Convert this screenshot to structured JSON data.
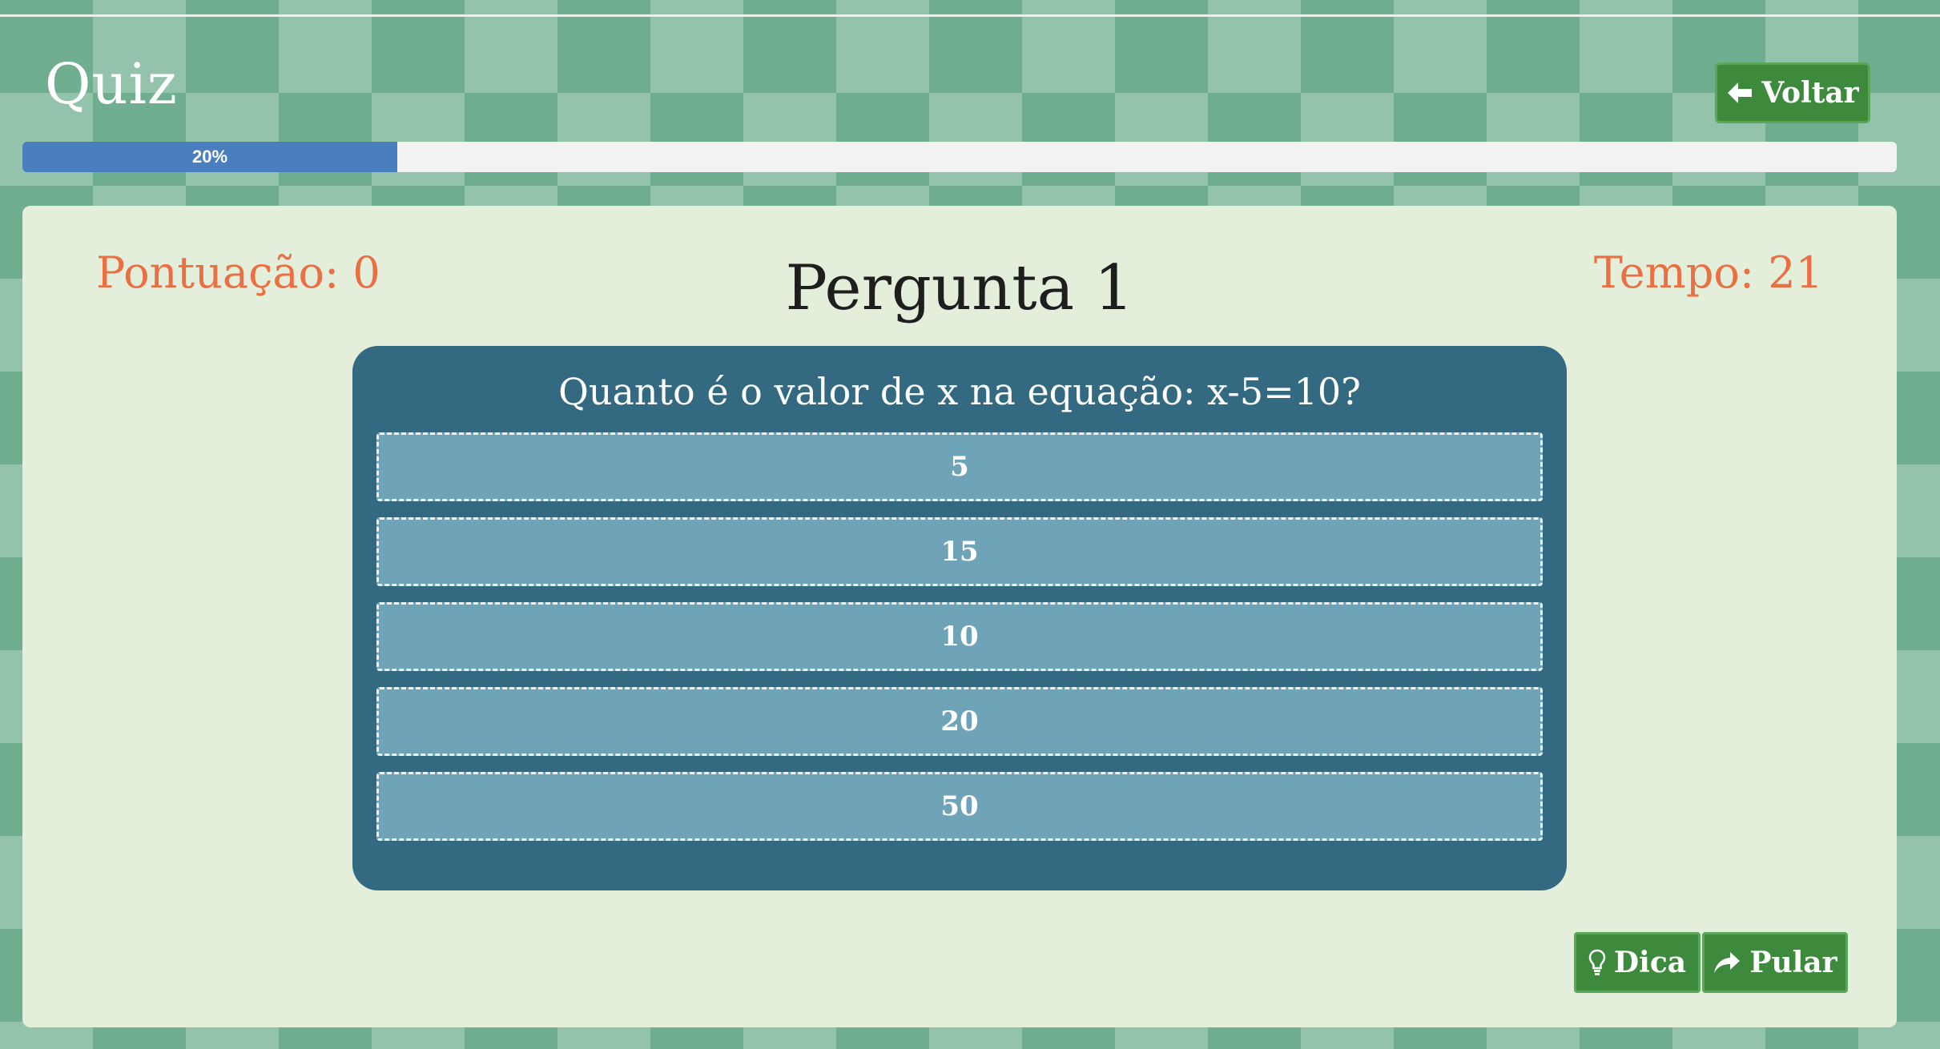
{
  "header": {
    "title": "Quiz",
    "back_label": "Voltar",
    "back_icon": "arrow-left-icon"
  },
  "progress": {
    "value_percent": 20,
    "label": "20%",
    "fill_color": "#4a7fbf"
  },
  "stats": {
    "score": "Pontuação: 0",
    "timer": "Tempo: 21",
    "color": "#ea7044"
  },
  "question": {
    "number_label": "Pergunta 1",
    "text": "Quanto é o valor de x na equação: x-5=10?",
    "options": [
      "5",
      "15",
      "10",
      "20",
      "50"
    ]
  },
  "actions": {
    "hint_label": "Dica",
    "hint_icon": "lightbulb-icon",
    "skip_label": "Pular",
    "skip_icon": "share-arrow-icon"
  },
  "colors": {
    "button_green": "#3d8a3d",
    "card_blue": "#336a82",
    "option_blue": "#6fa3b8",
    "panel_bg": "#e3efdb"
  }
}
